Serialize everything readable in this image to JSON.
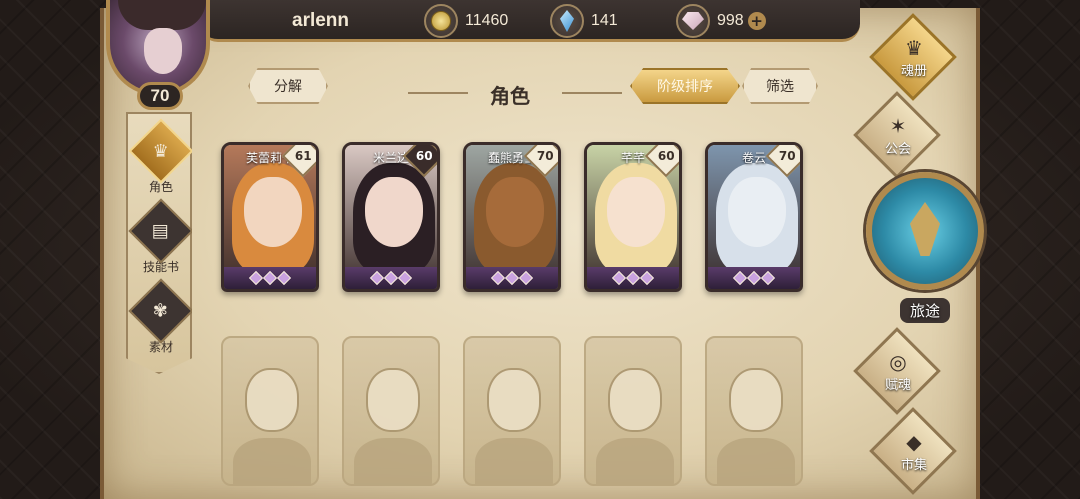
{
  "header": {
    "username": "arlenn",
    "gold": "11460",
    "crystal": "141",
    "gem": "998",
    "plus": "+"
  },
  "player": {
    "level": "70"
  },
  "side_nav": [
    {
      "label": "角色",
      "icon": "character-icon",
      "active": true
    },
    {
      "label": "技能书",
      "icon": "skill-book-icon",
      "active": false
    },
    {
      "label": "素材",
      "icon": "material-icon",
      "active": false
    }
  ],
  "toolbar": {
    "decompose": "分解",
    "title": "角色",
    "sort": "阶级排序",
    "filter": "筛选"
  },
  "characters": [
    {
      "name": "芙蕾莉卡",
      "level": "61",
      "hair": "#d98a3e",
      "skin": "#f2d6bf",
      "bg": "#b5795a"
    },
    {
      "name": "米兰达",
      "level": "60",
      "hair": "#2b1f24",
      "skin": "#f0d7cb",
      "bg": "#d9c8c3"
    },
    {
      "name": "蠢熊勇士",
      "level": "70",
      "hair": "#8a5a2e",
      "skin": "#a66b3a",
      "bg": "#9ea6a2"
    },
    {
      "name": "芊芊",
      "level": "60",
      "hair": "#f0dba2",
      "skin": "#f6e1cf",
      "bg": "#c8d3a6"
    },
    {
      "name": "卷云",
      "level": "70",
      "hair": "#d7e0ea",
      "skin": "#e9eef3",
      "bg": "#7e95ad"
    }
  ],
  "locked_count": 5,
  "right_nav": {
    "soul_book": "魂册",
    "guild": "公会",
    "journey": "旅途",
    "soul_gift": "赋魂",
    "market": "市集"
  }
}
